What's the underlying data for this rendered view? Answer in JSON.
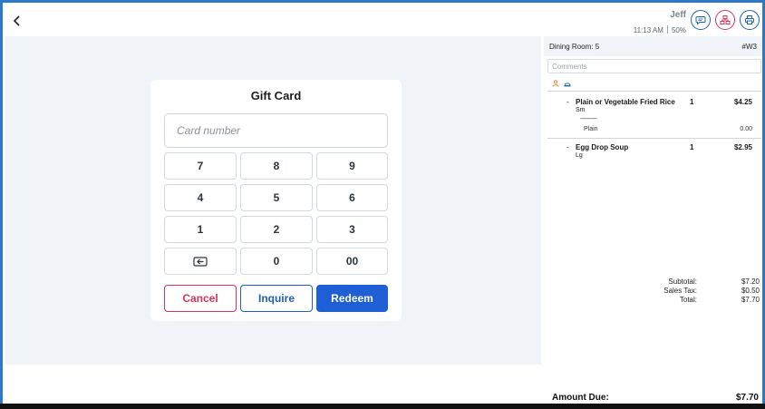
{
  "header": {
    "user_name": "Jeff",
    "time": "11:13 AM",
    "battery": "50%"
  },
  "gift_card": {
    "title": "Gift Card",
    "card_number_placeholder": "Card number",
    "keys": [
      "7",
      "8",
      "9",
      "4",
      "5",
      "6",
      "1",
      "2",
      "3",
      "",
      "0",
      "00"
    ],
    "cancel_label": "Cancel",
    "inquire_label": "Inquire",
    "redeem_label": "Redeem"
  },
  "order": {
    "room": "Dining Room: 5",
    "order_number": "#W3",
    "comments_placeholder": "Comments",
    "items": [
      {
        "dash": "-",
        "name": "Plain or Vegetable Fried Rice",
        "qty": "1",
        "price": "$4.25",
        "size": "Sm",
        "modifier_separator": "----------",
        "modifier_name": "Plain",
        "modifier_price": "0.00"
      },
      {
        "dash": "-",
        "name": "Egg Drop Soup",
        "qty": "1",
        "price": "$2.95",
        "size": "Lg"
      }
    ],
    "totals": {
      "subtotal_label": "Subtotal:",
      "subtotal": "$7.20",
      "tax_label": "Sales Tax:",
      "tax": "$0.50",
      "total_label": "Total:",
      "total": "$7.70"
    },
    "amount_due_label": "Amount Due:",
    "amount_due": "$7.70"
  },
  "colors": {
    "primary": "#1f5fd6",
    "danger": "#d8335c",
    "panel_bg": "#f0f4f8",
    "frame": "#2d79c7"
  }
}
